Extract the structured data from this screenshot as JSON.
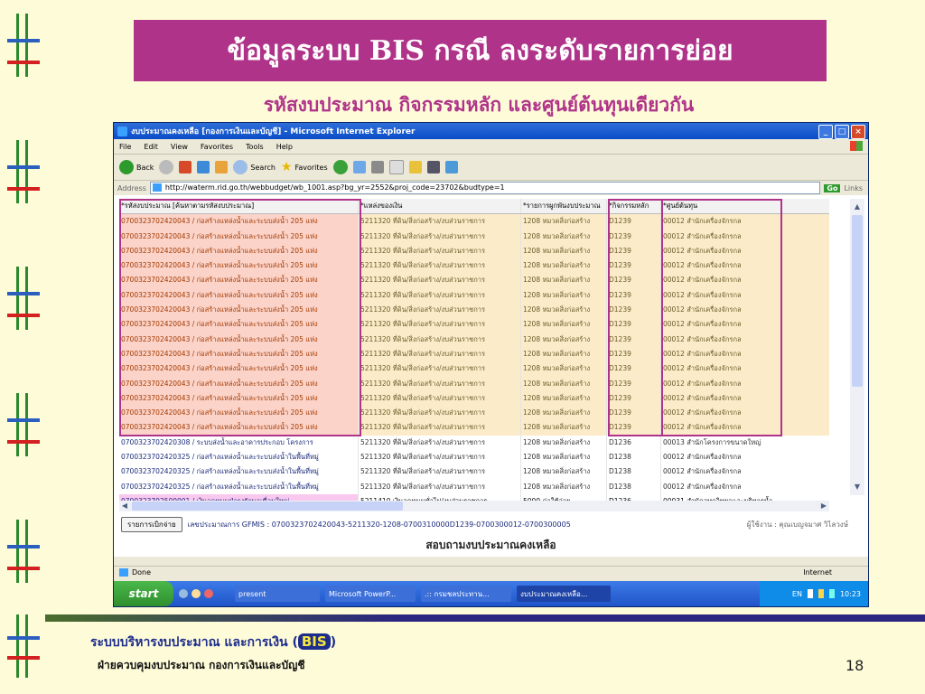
{
  "slide": {
    "title": "ข้อมูลระบบ BIS  กรณี ลงระดับรายการย่อย",
    "subtitle": "รหัสงบประมาณ กิจกรรมหลัก และศูนย์ต้นทุนเดียวกัน",
    "footer_org": "ระบบบริหารงบประมาณ  และการเงิน (",
    "footer_bis": "BIS",
    "footer_close": ")",
    "footer_dept": "ฝ่ายควบคุมงบประมาณ  กองการเงินและบัญชี",
    "page_number": "18",
    "accent_color": "#b0338a"
  },
  "browser": {
    "window_title": "งบประมาณคงเหลือ [กองการเงินและบัญชี] - Microsoft Internet Explorer",
    "menu": [
      "File",
      "Edit",
      "View",
      "Favorites",
      "Tools",
      "Help"
    ],
    "toolbar": {
      "back": "Back",
      "search": "Search",
      "favorites": "Favorites"
    },
    "address_label": "Address",
    "url": "http://waterm.rid.go.th/webbudget/wb_1001.asp?bg_yr=2552&proj_code=23702&budtype=1",
    "go": "Go",
    "links": "Links",
    "status": "Done",
    "zone": "Internet"
  },
  "table": {
    "headers": [
      "*รหัสงบประมาณ [ค้นหาตามรหัสงบประมาณ]",
      "*แหล่งของเงิน",
      "*รายการผูกพันงบประมาณ",
      "*กิจกรรมหลัก",
      "*ศูนย์ต้นทุน"
    ],
    "rows": [
      {
        "style": "hi",
        "cells": [
          "0700323702420043 / ก่อสร้างแหล่งน้ำและระบบส่งน้ำ 205 แห่ง",
          "5211320 ที่ดิน/สิ่งก่อสร้าง/งบส่วนราชการ",
          "1208 หมวดสิ่งก่อสร้าง",
          "D1239",
          "00012 สำนักเครื่องจักรกล"
        ]
      },
      {
        "style": "hi",
        "cells": [
          "0700323702420043 / ก่อสร้างแหล่งน้ำและระบบส่งน้ำ 205 แห่ง",
          "5211320 ที่ดิน/สิ่งก่อสร้าง/งบส่วนราชการ",
          "1208 หมวดสิ่งก่อสร้าง",
          "D1239",
          "00012 สำนักเครื่องจักรกล"
        ]
      },
      {
        "style": "hi",
        "cells": [
          "0700323702420043 / ก่อสร้างแหล่งน้ำและระบบส่งน้ำ 205 แห่ง",
          "5211320 ที่ดิน/สิ่งก่อสร้าง/งบส่วนราชการ",
          "1208 หมวดสิ่งก่อสร้าง",
          "D1239",
          "00012 สำนักเครื่องจักรกล"
        ]
      },
      {
        "style": "hi",
        "cells": [
          "0700323702420043 / ก่อสร้างแหล่งน้ำและระบบส่งน้ำ 205 แห่ง",
          "5211320 ที่ดิน/สิ่งก่อสร้าง/งบส่วนราชการ",
          "1208 หมวดสิ่งก่อสร้าง",
          "D1239",
          "00012 สำนักเครื่องจักรกล"
        ]
      },
      {
        "style": "hi",
        "cells": [
          "0700323702420043 / ก่อสร้างแหล่งน้ำและระบบส่งน้ำ 205 แห่ง",
          "5211320 ที่ดิน/สิ่งก่อสร้าง/งบส่วนราชการ",
          "1208 หมวดสิ่งก่อสร้าง",
          "D1239",
          "00012 สำนักเครื่องจักรกล"
        ]
      },
      {
        "style": "hi",
        "cells": [
          "0700323702420043 / ก่อสร้างแหล่งน้ำและระบบส่งน้ำ 205 แห่ง",
          "5211320 ที่ดิน/สิ่งก่อสร้าง/งบส่วนราชการ",
          "1208 หมวดสิ่งก่อสร้าง",
          "D1239",
          "00012 สำนักเครื่องจักรกล"
        ]
      },
      {
        "style": "hi",
        "cells": [
          "0700323702420043 / ก่อสร้างแหล่งน้ำและระบบส่งน้ำ 205 แห่ง",
          "5211320 ที่ดิน/สิ่งก่อสร้าง/งบส่วนราชการ",
          "1208 หมวดสิ่งก่อสร้าง",
          "D1239",
          "00012 สำนักเครื่องจักรกล"
        ]
      },
      {
        "style": "hi",
        "cells": [
          "0700323702420043 / ก่อสร้างแหล่งน้ำและระบบส่งน้ำ 205 แห่ง",
          "5211320 ที่ดิน/สิ่งก่อสร้าง/งบส่วนราชการ",
          "1208 หมวดสิ่งก่อสร้าง",
          "D1239",
          "00012 สำนักเครื่องจักรกล"
        ]
      },
      {
        "style": "hi",
        "cells": [
          "0700323702420043 / ก่อสร้างแหล่งน้ำและระบบส่งน้ำ 205 แห่ง",
          "5211320 ที่ดิน/สิ่งก่อสร้าง/งบส่วนราชการ",
          "1208 หมวดสิ่งก่อสร้าง",
          "D1239",
          "00012 สำนักเครื่องจักรกล"
        ]
      },
      {
        "style": "hi",
        "cells": [
          "0700323702420043 / ก่อสร้างแหล่งน้ำและระบบส่งน้ำ 205 แห่ง",
          "5211320 ที่ดิน/สิ่งก่อสร้าง/งบส่วนราชการ",
          "1208 หมวดสิ่งก่อสร้าง",
          "D1239",
          "00012 สำนักเครื่องจักรกล"
        ]
      },
      {
        "style": "hi",
        "cells": [
          "0700323702420043 / ก่อสร้างแหล่งน้ำและระบบส่งน้ำ 205 แห่ง",
          "5211320 ที่ดิน/สิ่งก่อสร้าง/งบส่วนราชการ",
          "1208 หมวดสิ่งก่อสร้าง",
          "D1239",
          "00012 สำนักเครื่องจักรกล"
        ]
      },
      {
        "style": "hi",
        "cells": [
          "0700323702420043 / ก่อสร้างแหล่งน้ำและระบบส่งน้ำ 205 แห่ง",
          "5211320 ที่ดิน/สิ่งก่อสร้าง/งบส่วนราชการ",
          "1208 หมวดสิ่งก่อสร้าง",
          "D1239",
          "00012 สำนักเครื่องจักรกล"
        ]
      },
      {
        "style": "hi",
        "cells": [
          "0700323702420043 / ก่อสร้างแหล่งน้ำและระบบส่งน้ำ 205 แห่ง",
          "5211320 ที่ดิน/สิ่งก่อสร้าง/งบส่วนราชการ",
          "1208 หมวดสิ่งก่อสร้าง",
          "D1239",
          "00012 สำนักเครื่องจักรกล"
        ]
      },
      {
        "style": "hi",
        "cells": [
          "0700323702420043 / ก่อสร้างแหล่งน้ำและระบบส่งน้ำ 205 แห่ง",
          "5211320 ที่ดิน/สิ่งก่อสร้าง/งบส่วนราชการ",
          "1208 หมวดสิ่งก่อสร้าง",
          "D1239",
          "00012 สำนักเครื่องจักรกล"
        ]
      },
      {
        "style": "hi",
        "cells": [
          "0700323702420043 / ก่อสร้างแหล่งน้ำและระบบส่งน้ำ 205 แห่ง",
          "5211320 ที่ดิน/สิ่งก่อสร้าง/งบส่วนราชการ",
          "1208 หมวดสิ่งก่อสร้าง",
          "D1239",
          "00012 สำนักเครื่องจักรกล"
        ]
      },
      {
        "style": "lo",
        "cells": [
          "0700323702420308 / ระบบส่งน้ำและอาคารประกอบ โครงการ",
          "5211320 ที่ดิน/สิ่งก่อสร้าง/งบส่วนราชการ",
          "1208 หมวดสิ่งก่อสร้าง",
          "D1236",
          "00013 สำนักโครงการขนาดใหญ่"
        ]
      },
      {
        "style": "lo",
        "cells": [
          "0700323702420325 / ก่อสร้างแหล่งน้ำและระบบส่งน้ำในพื้นที่หมู่",
          "5211320 ที่ดิน/สิ่งก่อสร้าง/งบส่วนราชการ",
          "1208 หมวดสิ่งก่อสร้าง",
          "D1238",
          "00012 สำนักเครื่องจักรกล"
        ]
      },
      {
        "style": "lo",
        "cells": [
          "0700323702420325 / ก่อสร้างแหล่งน้ำและระบบส่งน้ำในพื้นที่หมู่",
          "5211320 ที่ดิน/สิ่งก่อสร้าง/งบส่วนราชการ",
          "1208 หมวดสิ่งก่อสร้าง",
          "D1238",
          "00012 สำนักเครื่องจักรกล"
        ]
      },
      {
        "style": "lo",
        "cells": [
          "0700323702420325 / ก่อสร้างแหล่งน้ำและระบบส่งน้ำในพื้นที่หมู่",
          "5211320 ที่ดิน/สิ่งก่อสร้าง/งบส่วนราชการ",
          "1208 หมวดสิ่งก่อสร้าง",
          "D1238",
          "00012 สำนักเครื่องจักรกล"
        ]
      },
      {
        "style": "pink",
        "cells": [
          "0700323702500001 / เงินอุดหนุนบำรุงรักษาเขื่อนใหญ่",
          "5211410 เงินอุดหนุนทั่วไป/งบส่วนราชการ",
          "5000 ค่าใช้จ่าย",
          "D1236",
          "00031 สำนักอุทกวิทยาและบริหารน้ำ"
        ]
      }
    ]
  },
  "detail": {
    "button": "รายการเบิกจ่าย",
    "gfmis_line": "เลขประมาณการ GFMIS : 0700323702420043-5211320-1208-0700310000D1239-0700300012-0700300005",
    "user_line": "ผู้ใช้งาน : คุณเบญจมาศ วิไลวงษ์",
    "caption": "สอบถามงบประมาณคงเหลือ"
  },
  "taskbar": {
    "start": "start",
    "tasks": [
      "present",
      "Microsoft PowerP...",
      ".:: กรมชลประทาน...",
      "งบประมาณคงเหลือ..."
    ],
    "lang": "EN",
    "clock": "10:23"
  }
}
